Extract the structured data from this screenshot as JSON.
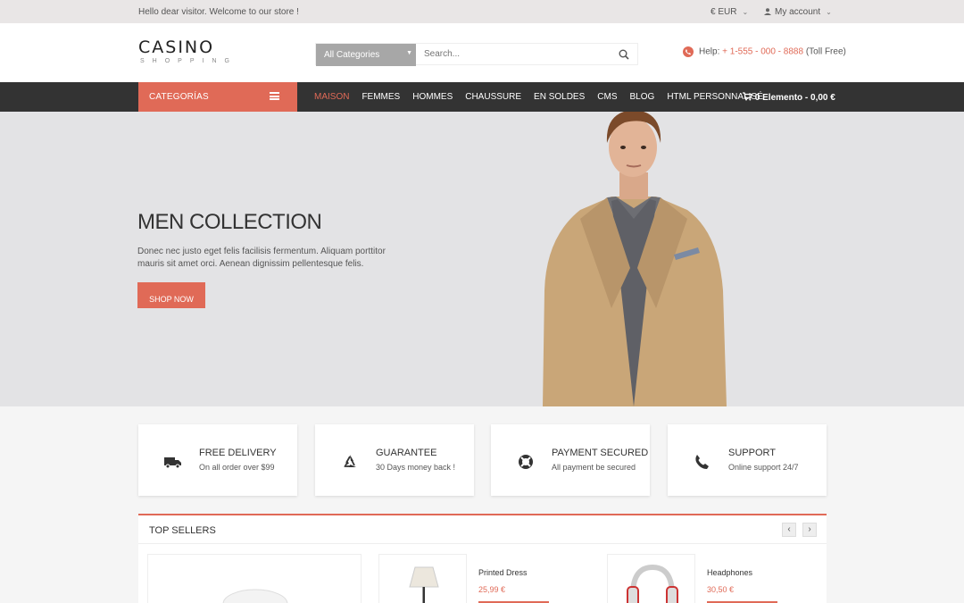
{
  "topbar": {
    "welcome": "Hello dear visitor. Welcome to our store !",
    "currency": "€  EUR",
    "account": "My account"
  },
  "header": {
    "logo_main": "CASINO",
    "logo_sub": "SHOPPING",
    "search_category": "All Categories",
    "search_placeholder": "Search...",
    "help_label": "Help:",
    "help_number": "+ 1-555 - 000 - 8888",
    "help_note": "(Toll Free)"
  },
  "nav": {
    "categories_label": "CATEGORÍAS",
    "items": [
      "MAISON",
      "FEMMES",
      "HOMMES",
      "CHAUSSURE",
      "EN SOLDES",
      "CMS",
      "BLOG",
      "HTML PERSONNALISÉ"
    ],
    "cart": "0 Elemento - 0,00 €"
  },
  "hero": {
    "title": "MEN COLLECTION",
    "text": "Donec nec justo eget felis facilisis fermentum. Aliquam porttitor mauris sit amet orci. Aenean dignissim pellentesque felis.",
    "button": "SHOP NOW"
  },
  "features": [
    {
      "title": "FREE DELIVERY",
      "subtitle": "On all order over $99",
      "icon": "truck-icon"
    },
    {
      "title": "GUARANTEE",
      "subtitle": "30 Days money back !",
      "icon": "recycle-icon"
    },
    {
      "title": "PAYMENT SECURED",
      "subtitle": "All payment be secured",
      "icon": "lifebuoy-icon"
    },
    {
      "title": "SUPPORT",
      "subtitle": "Online support 24/7",
      "icon": "phone-icon"
    }
  ],
  "sellers": {
    "title": "TOP SELLERS",
    "products": [
      {
        "name": "Printed Dress",
        "price": "25,99 €"
      },
      {
        "name": "Headphones",
        "price": "30,50 €"
      }
    ]
  },
  "colors": {
    "accent": "#e06a57",
    "nav_bg": "#333333",
    "topbar_bg": "#e9e6e6",
    "hero_bg": "#e3e3e5"
  }
}
